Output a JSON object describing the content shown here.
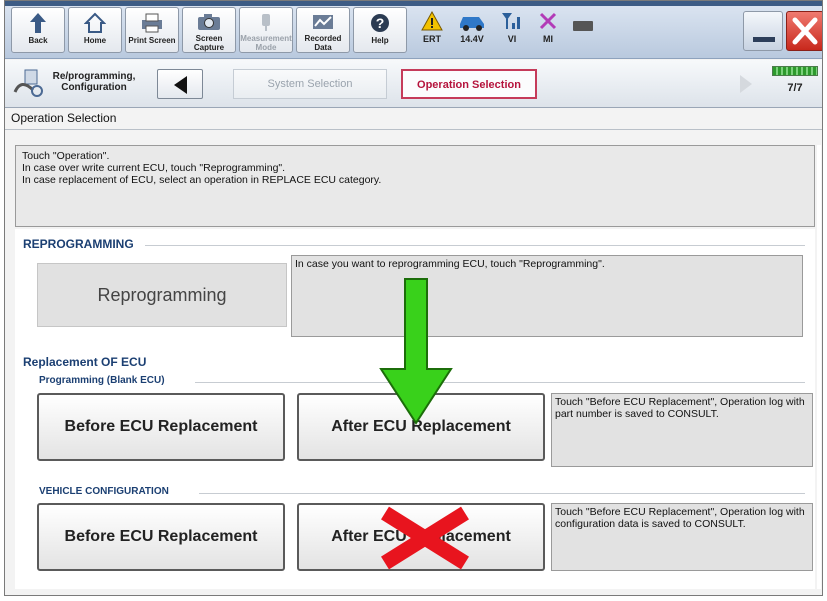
{
  "toolbar": {
    "buttons": [
      {
        "label": "Back",
        "icon": "back-arrow-icon"
      },
      {
        "label": "Home",
        "icon": "home-icon"
      },
      {
        "label": "Print Screen",
        "icon": "printer-icon"
      },
      {
        "label": "Screen Capture",
        "icon": "camera-icon"
      },
      {
        "label": "Measurement Mode",
        "icon": "probe-icon",
        "disabled": true
      },
      {
        "label": "Recorded Data",
        "icon": "recorded-data-icon"
      },
      {
        "label": "Help",
        "icon": "help-icon"
      }
    ],
    "status": [
      {
        "label": "ERT",
        "icon": "warning-icon"
      },
      {
        "label": "14.4V",
        "icon": "car-icon"
      },
      {
        "label": "VI",
        "icon": "signal-icon"
      },
      {
        "label": "MI",
        "icon": "x-mark-icon"
      }
    ]
  },
  "nav": {
    "reprog_label": "Re/programming, Configuration",
    "crumbs": [
      "System Selection",
      "Operation Selection"
    ],
    "page_counter": "7/7"
  },
  "main": {
    "title": "Operation Selection",
    "instructions": [
      "Touch \"Operation\".",
      "In case over write current ECU, touch \"Reprogramming\".",
      "In case replacement of ECU, select an operation in REPLACE ECU category."
    ],
    "reprogramming": {
      "section_title": "REPROGRAMMING",
      "button_label": "Reprogramming",
      "description": "In case you want to reprogramming ECU, touch \"Reprogramming\"."
    },
    "replacement": {
      "section_title": "Replacement OF ECU",
      "programming": {
        "sub_title": "Programming (Blank ECU)",
        "before_label": "Before ECU Replacement",
        "after_label": "After ECU Replacement",
        "description": "Touch \"Before ECU Replacement\", Operation log with part number is saved to CONSULT."
      },
      "vehicle_config": {
        "sub_title": "VEHICLE CONFIGURATION",
        "before_label": "Before ECU Replacement",
        "after_label": "After ECU Replacement",
        "description": "Touch \"Before ECU Replacement\", Operation log with configuration data is saved to CONSULT."
      }
    }
  },
  "colors": {
    "section_title": "#1b3f72",
    "active_crumb": "#b5133c",
    "green_arrow": "#39d11b",
    "red_cross": "#e8141e"
  }
}
